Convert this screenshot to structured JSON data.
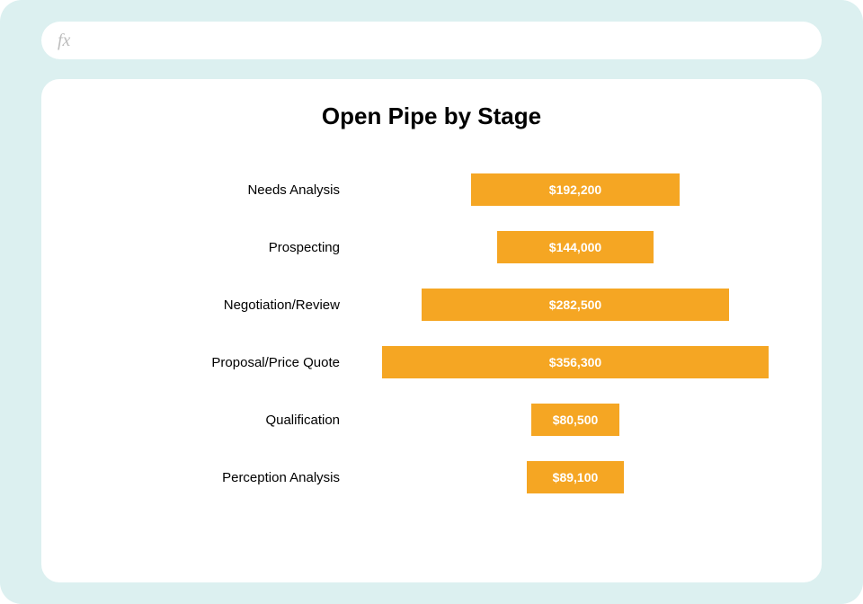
{
  "formula_bar": {
    "fx_label": "fx",
    "value": ""
  },
  "chart_data": {
    "type": "bar",
    "title": "Open Pipe by Stage",
    "orientation": "horizontal",
    "alignment": "center",
    "bar_color": "#f5a623",
    "categories": [
      "Needs Analysis",
      "Prospecting",
      "Negotiation/Review",
      "Proposal/Price Quote",
      "Qualification",
      "Perception Analysis"
    ],
    "values": [
      192200,
      144000,
      282500,
      356300,
      80500,
      89100
    ],
    "value_labels": [
      "$192,200",
      "$144,000",
      "$282,500",
      "$356,300",
      "$80,500",
      "$89,100"
    ],
    "xlabel": "",
    "ylabel": ""
  }
}
